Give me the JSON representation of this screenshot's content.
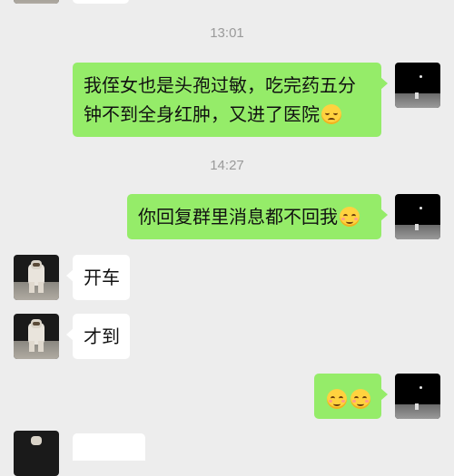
{
  "chat": {
    "timestamps": [
      "13:01",
      "14:27"
    ],
    "messages": [
      {
        "sender": "me",
        "text": "我侄女也是头孢过敏，吃完药五分钟不到全身红肿，又进了医院",
        "emoji": "pensive-face"
      },
      {
        "sender": "me",
        "text": "你回复群里消息都不回我",
        "emoji": "smiling-face"
      },
      {
        "sender": "other",
        "text": "开车"
      },
      {
        "sender": "other",
        "text": "才到"
      },
      {
        "sender": "me",
        "text": "",
        "emoji": "smiling-face x2"
      }
    ]
  },
  "colors": {
    "background": "#ededed",
    "my_bubble": "#95ec69",
    "their_bubble": "#ffffff",
    "timestamp": "#9a9a9a"
  }
}
